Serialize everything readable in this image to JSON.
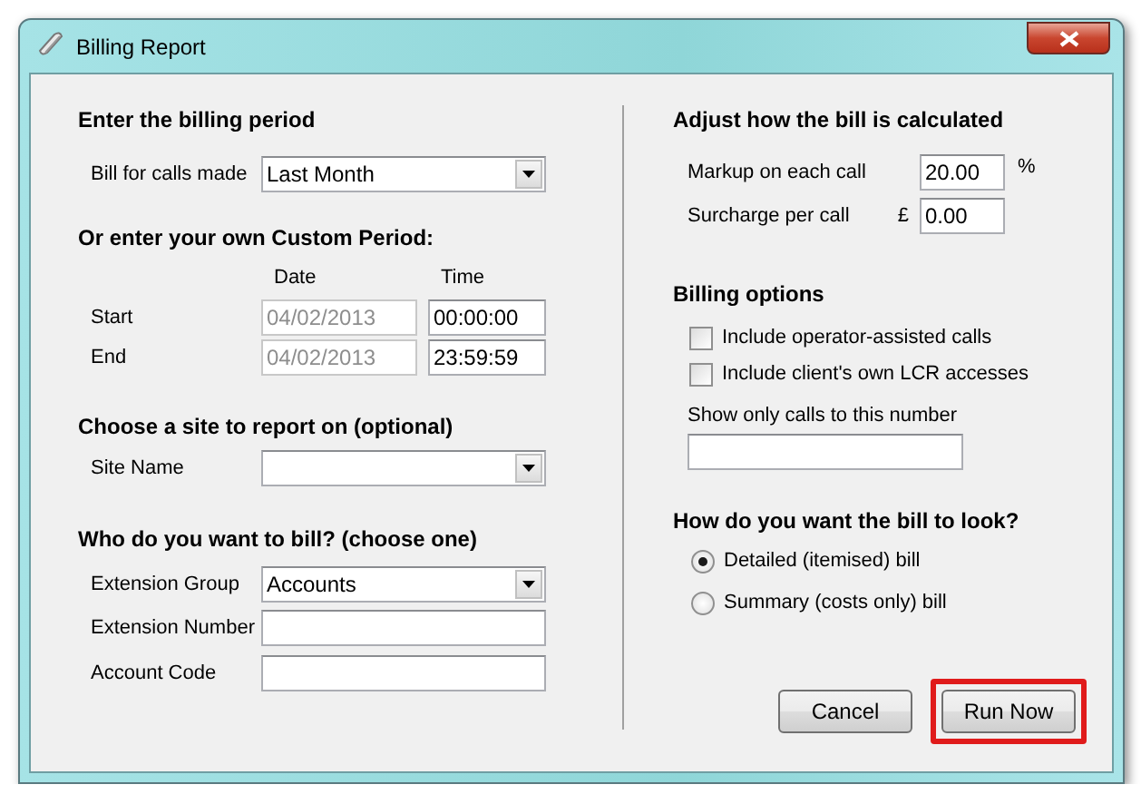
{
  "window": {
    "title": "Billing Report"
  },
  "billing_period": {
    "heading": "Enter the billing period",
    "fields": [
      {
        "label": "Bill for calls made",
        "kind": "dropdown",
        "value": "Last Month"
      }
    ]
  },
  "custom_period": {
    "heading": "Or enter your own Custom Period:",
    "columns": [
      "Date",
      "Time"
    ],
    "rows": [
      {
        "label": "Start",
        "date": "04/02/2013",
        "time": "00:00:00",
        "date_disabled": true
      },
      {
        "label": "End",
        "date": "04/02/2013",
        "time": "23:59:59",
        "date_disabled": true
      }
    ]
  },
  "site": {
    "heading": "Choose a site to report on (optional)",
    "fields": [
      {
        "label": "Site Name",
        "kind": "dropdown"
      }
    ]
  },
  "bill_to": {
    "heading": "Who do you want to bill? (choose one)",
    "fields": [
      {
        "label": "Extension Group",
        "kind": "dropdown",
        "value": "Accounts"
      },
      {
        "label": "Extension Number",
        "kind": "text"
      },
      {
        "label": "Account Code",
        "kind": "text"
      }
    ]
  },
  "calculation": {
    "heading": "Adjust how the bill is calculated",
    "fields": [
      {
        "label": "Markup on each call",
        "value": "20.00",
        "suffix": "%"
      },
      {
        "label": "Surcharge per call",
        "prefix": "£",
        "value": "0.00"
      }
    ]
  },
  "options": {
    "heading": "Billing options",
    "checkboxes": [
      {
        "label": "Include operator-assisted calls",
        "checked": false
      },
      {
        "label": "Include client's own LCR accesses",
        "checked": false
      }
    ],
    "number_label": "Show only calls to this number"
  },
  "bill_style": {
    "heading": "How do you want the bill to look?",
    "choices": [
      {
        "label": "Detailed (itemised) bill",
        "selected": true
      },
      {
        "label": "Summary (costs only) bill",
        "selected": false
      }
    ]
  },
  "buttons": [
    {
      "label": "Cancel",
      "highlighted": false
    },
    {
      "label": "Run Now",
      "highlighted": true
    }
  ]
}
